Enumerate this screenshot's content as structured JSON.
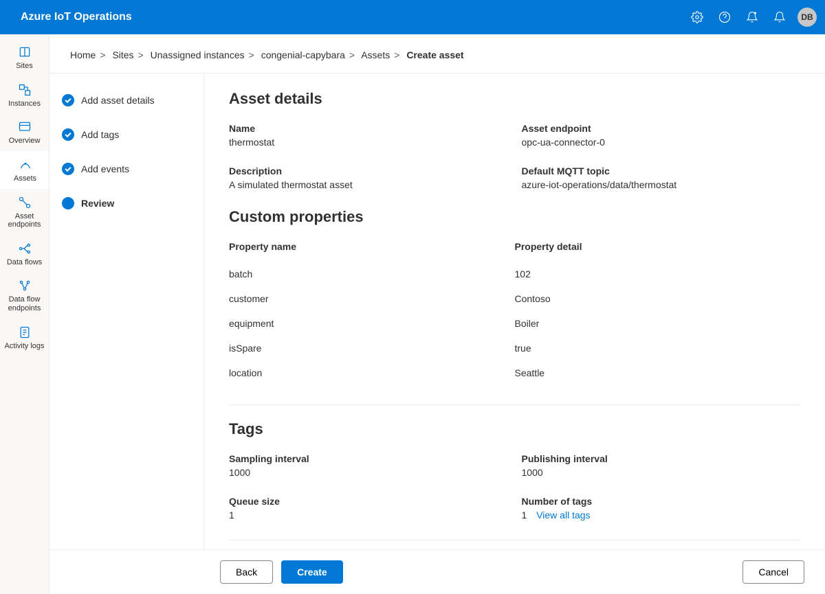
{
  "header": {
    "title": "Azure IoT Operations",
    "avatar": "DB"
  },
  "leftnav": [
    {
      "id": "sites",
      "label": "Sites"
    },
    {
      "id": "instances",
      "label": "Instances"
    },
    {
      "id": "overview",
      "label": "Overview"
    },
    {
      "id": "assets",
      "label": "Assets",
      "active": true
    },
    {
      "id": "asset-endpoints",
      "label": "Asset endpoints"
    },
    {
      "id": "data-flows",
      "label": "Data flows"
    },
    {
      "id": "data-flow-endpoints",
      "label": "Data flow endpoints"
    },
    {
      "id": "activity-logs",
      "label": "Activity logs"
    }
  ],
  "breadcrumb": {
    "items": [
      "Home",
      "Sites",
      "Unassigned instances",
      "congenial-capybara",
      "Assets"
    ],
    "current": "Create asset"
  },
  "steps": [
    {
      "label": "Add asset details",
      "done": true
    },
    {
      "label": "Add tags",
      "done": true
    },
    {
      "label": "Add events",
      "done": true
    },
    {
      "label": "Review",
      "current": true
    }
  ],
  "sections": {
    "asset_details": {
      "heading": "Asset details",
      "name_label": "Name",
      "name_value": "thermostat",
      "endpoint_label": "Asset endpoint",
      "endpoint_value": "opc-ua-connector-0",
      "description_label": "Description",
      "description_value": "A simulated thermostat asset",
      "mqtt_label": "Default MQTT topic",
      "mqtt_value": "azure-iot-operations/data/thermostat"
    },
    "custom_props": {
      "heading": "Custom properties",
      "col_name": "Property name",
      "col_detail": "Property detail",
      "rows": [
        {
          "name": "batch",
          "detail": "102"
        },
        {
          "name": "customer",
          "detail": "Contoso"
        },
        {
          "name": "equipment",
          "detail": "Boiler"
        },
        {
          "name": "isSpare",
          "detail": "true"
        },
        {
          "name": "location",
          "detail": "Seattle"
        }
      ]
    },
    "tags": {
      "heading": "Tags",
      "sampling_label": "Sampling interval",
      "sampling_value": "1000",
      "publishing_label": "Publishing interval",
      "publishing_value": "1000",
      "queue_label": "Queue size",
      "queue_value": "1",
      "count_label": "Number of tags",
      "count_value": "1",
      "view_all": "View all tags"
    }
  },
  "footer": {
    "back": "Back",
    "create": "Create",
    "cancel": "Cancel"
  }
}
